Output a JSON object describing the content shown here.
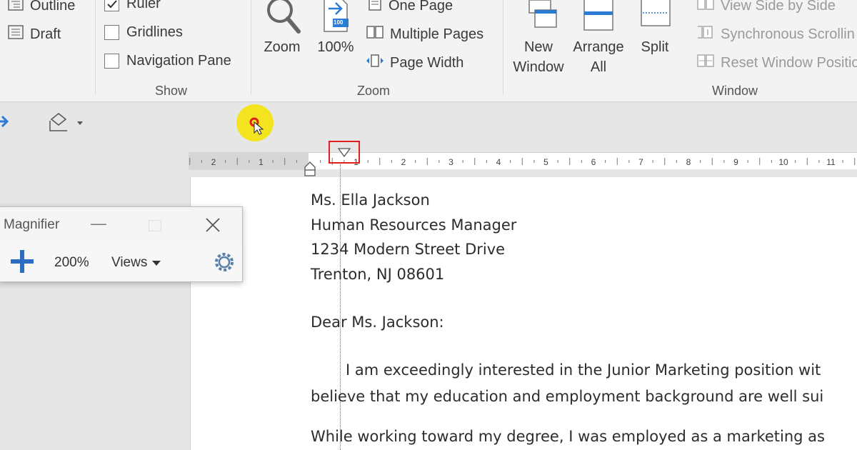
{
  "ribbon": {
    "views_group": {
      "outline_label": "Outline",
      "draft_label": "Draft"
    },
    "show_group": {
      "label": "Show",
      "ruler_label": "Ruler",
      "ruler_checked": true,
      "gridlines_label": "Gridlines",
      "navigation_pane_label": "Navigation Pane"
    },
    "zoom_group": {
      "label": "Zoom",
      "zoom_label": "Zoom",
      "hundred_label": "100%",
      "hundred_icon_text": "100",
      "one_page_label": "One Page",
      "multiple_pages_label": "Multiple Pages",
      "page_width_label": "Page Width"
    },
    "window_group": {
      "label": "Window",
      "new_window_line1": "New",
      "new_window_line2": "Window",
      "arrange_all_line1": "Arrange",
      "arrange_all_line2": "All",
      "split_label": "Split",
      "view_side_by_side_label": "View Side by Side",
      "synchronous_scrolling_label": "Synchronous Scrollin",
      "reset_window_position_label": "Reset Window Positio"
    }
  },
  "ruler": {
    "left_ticks": [
      "2",
      "1"
    ],
    "right_ticks": [
      "1",
      "2",
      "3",
      "4",
      "5",
      "6",
      "7",
      "8",
      "9",
      "10",
      "11"
    ]
  },
  "magnifier": {
    "title": "Magnifier",
    "zoom_level": "200%",
    "views_label": "Views"
  },
  "document": {
    "lines": [
      "Ms. Ella Jackson",
      "Human Resources Manager",
      "1234 Modern Street Drive",
      "Trenton, NJ 08601",
      "Dear Ms. Jackson:",
      "I am exceedingly interested in the Junior Marketing position wit",
      "believe that my education and employment background are well sui",
      "While working toward my degree, I was employed as a marketing as"
    ]
  },
  "colors": {
    "accent_blue": "#2b7bd3",
    "cursor_highlight": "#f4e41f",
    "highlight_box": "#e02020"
  }
}
